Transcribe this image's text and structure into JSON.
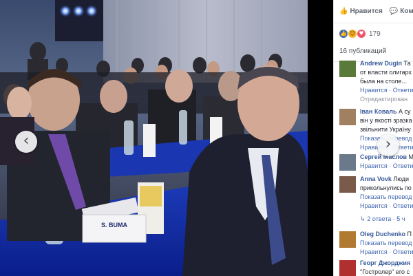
{
  "photo": {
    "placard_text": "S. BUMA"
  },
  "nav": {
    "prev_glyph": "‹",
    "next_glyph": "›"
  },
  "actions": {
    "like_label": "Нравится",
    "comment_label": "Комментировать"
  },
  "reactions": {
    "count": "179"
  },
  "publications_label": "16 публикаций",
  "comments": [
    {
      "author": "Andrew Dugin",
      "lines": [
        " Та",
        "от власти олигарх",
        "была на столе..."
      ],
      "meta_like": "Нравится",
      "meta_sep": " · ",
      "meta_reply": "Ответи",
      "edited": "Отредактирован",
      "avatar_color": "#5a7a3a"
    },
    {
      "author": "Іван Коваль",
      "lines": [
        " А су",
        "він у якості зразка",
        "звільнити Україну"
      ],
      "show_translation": "Показать перевод",
      "meta_like": "Нравится",
      "meta_sep": " · ",
      "meta_reply": "Ответи",
      "avatar_color": "#a08060"
    },
    {
      "author": "Сергей Маслов",
      "lines": [
        " М"
      ],
      "meta_like": "Нравится",
      "meta_sep": " · ",
      "meta_reply": "Ответи",
      "avatar_color": "#6b7a8a"
    },
    {
      "author": "Anna Vovk",
      "lines": [
        " Люди",
        "прикольнулись по"
      ],
      "show_translation": "Показать перевод",
      "meta_like": "Нравится",
      "meta_sep": " · ",
      "meta_reply": "Ответи",
      "replies": "2 ответа · 5 ч",
      "avatar_color": "#7a5a4a"
    },
    {
      "author": "Oleg Duchenko",
      "lines": [
        " П"
      ],
      "show_translation": "Показать перевод",
      "meta_like": "Нравится",
      "meta_sep": " · ",
      "meta_reply": "Ответи",
      "avatar_color": "#b07a30"
    },
    {
      "author": "Георг Джорджия",
      "lines": [
        "\"Гостролер\" его с"
      ],
      "avatar_color": "#b03030"
    }
  ]
}
